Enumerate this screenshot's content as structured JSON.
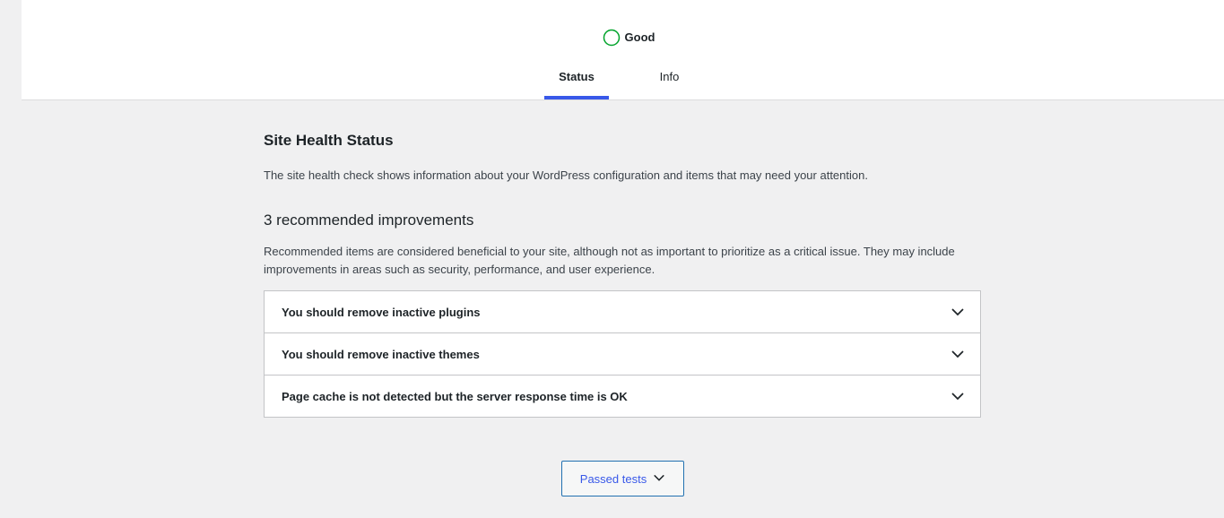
{
  "header": {
    "score_label": "Good",
    "tabs": [
      {
        "label": "Status",
        "active": true
      },
      {
        "label": "Info",
        "active": false
      }
    ]
  },
  "main": {
    "title": "Site Health Status",
    "description": "The site health check shows information about your WordPress configuration and items that may need your attention.",
    "improvements_heading": "3 recommended improvements",
    "improvements_description": "Recommended items are considered beneficial to your site, although not as important to prioritize as a critical issue. They may include improvements in areas such as security, performance, and user experience.",
    "items": [
      {
        "label": "You should remove inactive plugins",
        "icon": "chevron-down-icon"
      },
      {
        "label": "You should remove inactive themes",
        "icon": "chevron-down-icon"
      },
      {
        "label": "Page cache is not detected but the server response time is OK",
        "icon": "chevron-down-icon"
      }
    ],
    "passed_tests_label": "Passed tests"
  },
  "colors": {
    "accent": "#3858e9",
    "good": "#00a32a",
    "border": "#c3c4c7",
    "background": "#f0f0f1"
  }
}
